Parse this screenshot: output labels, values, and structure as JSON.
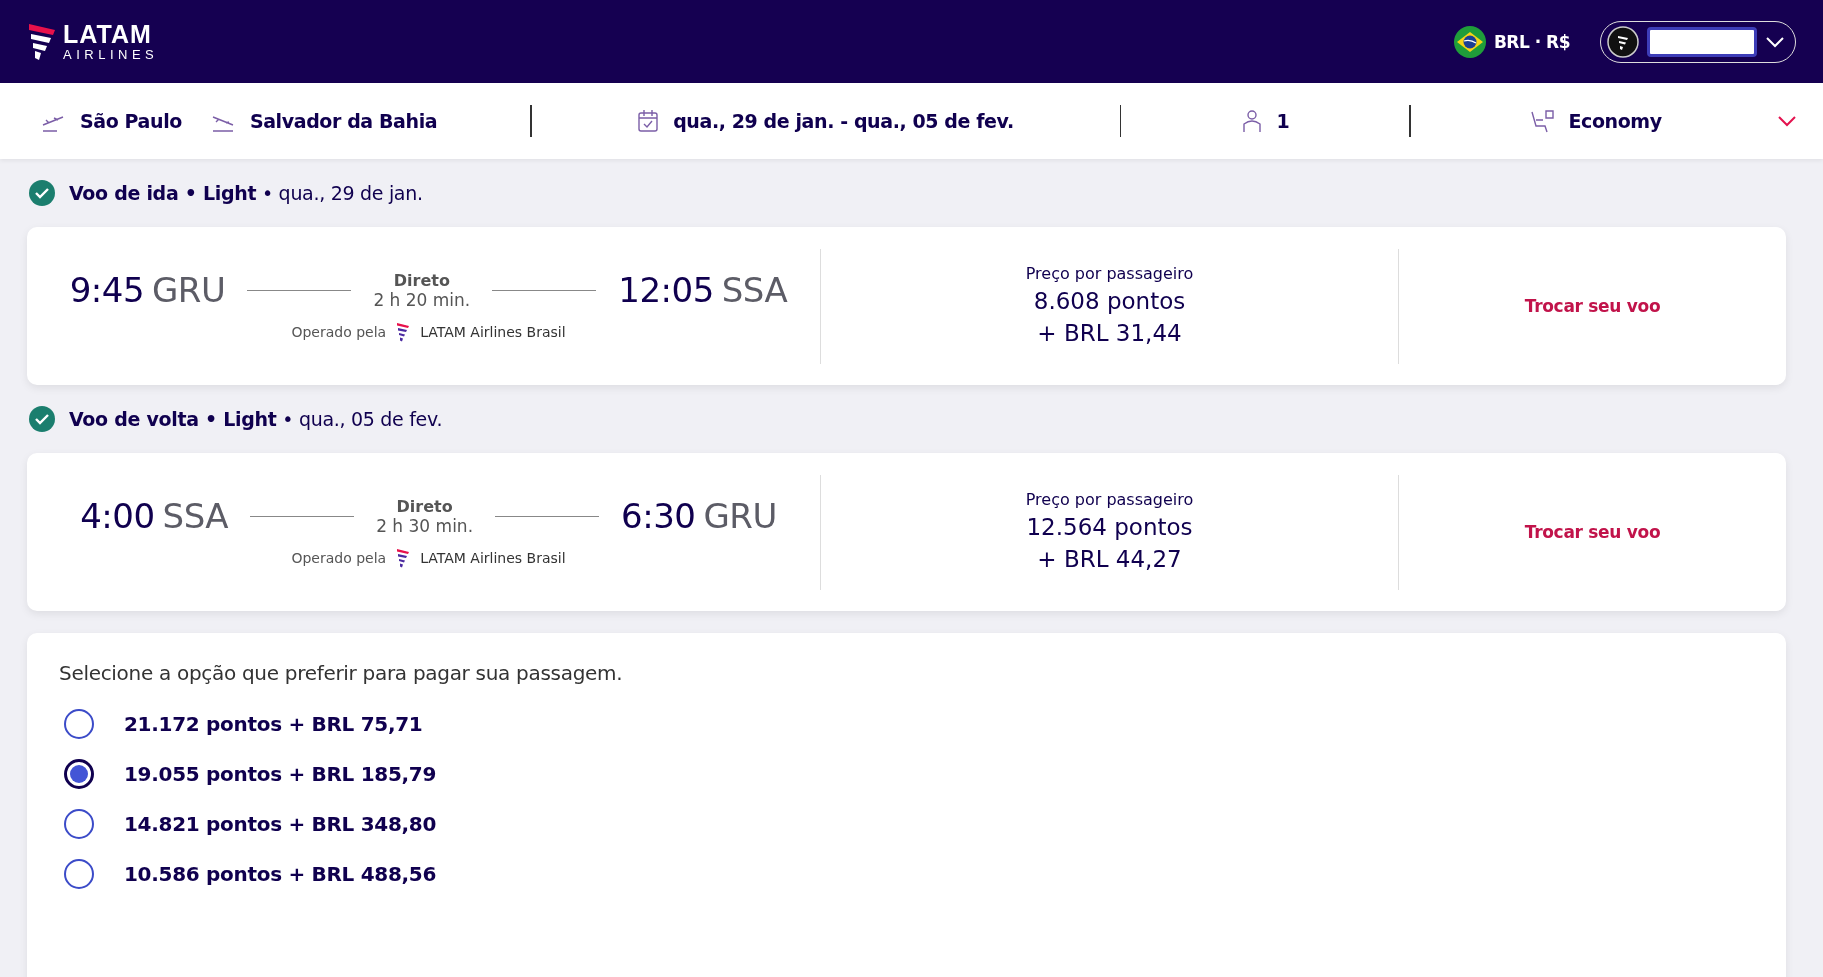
{
  "header": {
    "logo": {
      "name": "LATAM",
      "sub": "AIRLINES"
    },
    "currency": "BRL · R$"
  },
  "search": {
    "origin": "São Paulo",
    "destination": "Salvador da Bahia",
    "dates": "qua., 29 de jan. - qua., 05 de fev.",
    "passengers": "1",
    "cabin": "Economy"
  },
  "legs": [
    {
      "heading": "**Voo de ida • Light** • qua., 29 de jan.",
      "depart_time": "9:45",
      "depart_airport": "GRU",
      "arrive_time": "12:05",
      "arrive_airport": "SSA",
      "stops": "Direto",
      "duration": "2 h 20 min.",
      "operated_label": "Operado pela",
      "carrier": "LATAM Airlines Brasil",
      "price_label": "Preço por passageiro",
      "points": "8.608 pontos",
      "fee": "+ BRL 31,44",
      "action": "Trocar seu voo"
    },
    {
      "heading": "**Voo de volta • Light** • qua., 05 de fev.",
      "depart_time": "4:00",
      "depart_airport": "SSA",
      "arrive_time": "6:30",
      "arrive_airport": "GRU",
      "stops": "Direto",
      "duration": "2 h 30 min.",
      "operated_label": "Operado pela",
      "carrier": "LATAM Airlines Brasil",
      "price_label": "Preço por passageiro",
      "points": "12.564 pontos",
      "fee": "+ BRL 44,27",
      "action": "Trocar seu voo"
    }
  ],
  "payment": {
    "prompt": "Selecione a opção que preferir para pagar sua passagem.",
    "options": [
      {
        "label": "21.172 pontos + BRL 75,71",
        "selected": false
      },
      {
        "label": "19.055 pontos + BRL 185,79",
        "selected": true
      },
      {
        "label": "14.821 pontos + BRL 348,80",
        "selected": false
      },
      {
        "label": "10.586 pontos + BRL 488,56",
        "selected": false
      }
    ]
  }
}
